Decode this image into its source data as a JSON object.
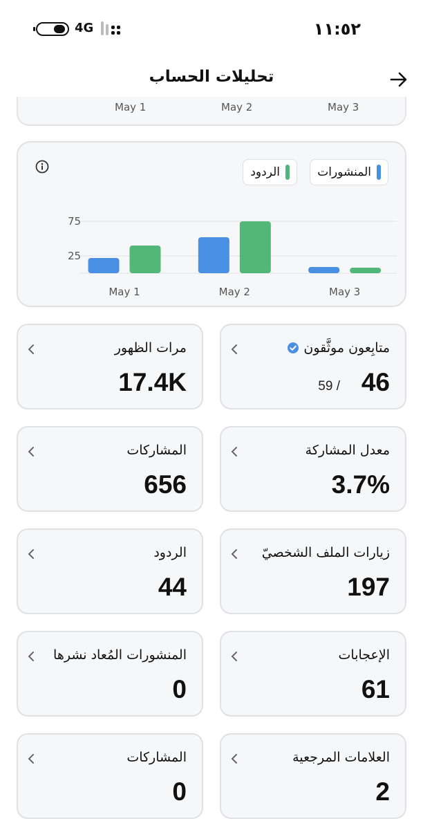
{
  "status_bar": {
    "time": "١١:٥٢",
    "network": "4G"
  },
  "header": {
    "title": "تحليلات الحساب",
    "back_icon": "arrow-right-icon"
  },
  "previous_chart": {
    "x_labels": [
      "May 1",
      "May 2",
      "May 3"
    ]
  },
  "chart_legend": {
    "posts_label": "المنشورات",
    "replies_label": "الردود"
  },
  "chart_data": {
    "type": "bar",
    "categories": [
      "May 1",
      "May 2",
      "May 3"
    ],
    "series": [
      {
        "name": "المنشورات",
        "values": [
          22,
          52,
          9
        ],
        "color": "#4a90e2"
      },
      {
        "name": "الردود",
        "values": [
          40,
          75,
          8
        ],
        "color": "#52b87a"
      }
    ],
    "y_ticks": [
      25,
      75
    ],
    "ylim": [
      0,
      100
    ]
  },
  "stats": [
    {
      "label": "متابِعون موثَّقون",
      "value": "46",
      "sub": "59  /",
      "verified": true
    },
    {
      "label": "مرات الظهور",
      "value": "17.4K"
    },
    {
      "label": "معدل المشاركة",
      "value": "3.7%"
    },
    {
      "label": "المشاركات",
      "value": "656"
    },
    {
      "label": "زيارات الملف الشخصيّ",
      "value": "197"
    },
    {
      "label": "الردود",
      "value": "44"
    },
    {
      "label": "الإعجابات",
      "value": "61"
    },
    {
      "label": "المنشورات المُعاد نشرها",
      "value": "0"
    },
    {
      "label": "العلامات المرجعية",
      "value": "2"
    },
    {
      "label": "المشاركات",
      "value": "0"
    }
  ]
}
